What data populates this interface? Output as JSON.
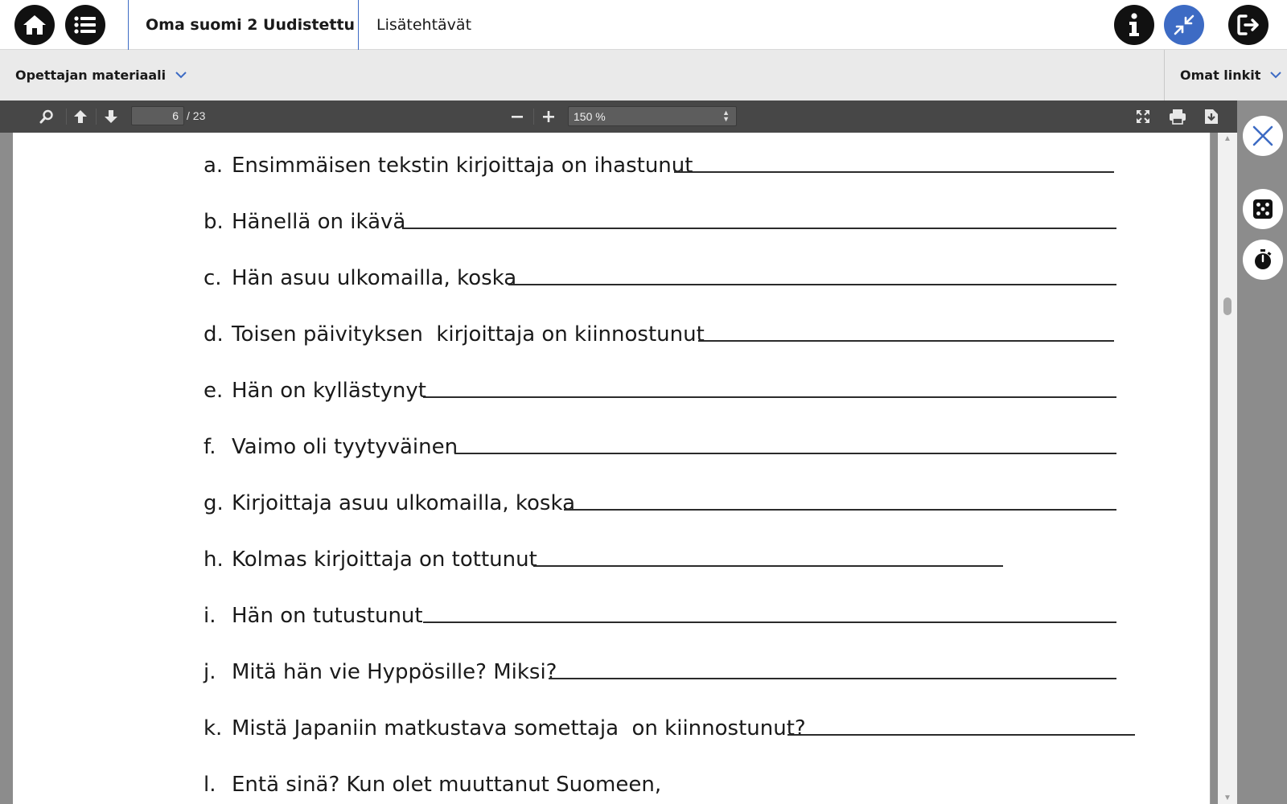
{
  "topbar": {
    "home_icon": "home-icon",
    "menu_icon": "list-icon",
    "book_title": "Oma suomi 2 Uudistettu",
    "extra_tab": "Lisätehtävät",
    "info_icon": "info-icon",
    "collapse_icon": "collapse-icon",
    "logout_icon": "logout-icon",
    "accent_color": "#3d6bc4"
  },
  "subbar": {
    "teacher_menu": "Opettajan materiaali",
    "links_menu": "Omat linkit"
  },
  "pdf_toolbar": {
    "current_page": "6",
    "page_count": "/ 23",
    "zoom": "150 %"
  },
  "worksheet": {
    "questions": [
      {
        "letter": "a.",
        "text": "Ensimmäisen tekstin kirjoittaja on ihastunut"
      },
      {
        "letter": "b.",
        "text": "Hänellä on ikävä"
      },
      {
        "letter": "c.",
        "text": "Hän asuu ulkomailla, koska"
      },
      {
        "letter": "d.",
        "text": "Toisen päivityksen  kirjoittaja on kiinnostunut"
      },
      {
        "letter": "e.",
        "text": "Hän on kyllästynyt"
      },
      {
        "letter": "f.",
        "text": "Vaimo oli tyytyväinen"
      },
      {
        "letter": "g.",
        "text": "Kirjoittaja asuu ulkomailla, koska"
      },
      {
        "letter": "h.",
        "text": "Kolmas kirjoittaja on tottunut"
      },
      {
        "letter": "i.",
        "text": "Hän on tutustunut"
      },
      {
        "letter": "j.",
        "text": "Mitä hän vie Hyppösille? Miksi?"
      },
      {
        "letter": "k.",
        "text": "Mistä Japaniin matkustava somettaja  on kiinnostunut?"
      },
      {
        "letter": "l.",
        "text": "Entä sinä? Kun olet muuttanut Suomeen,"
      }
    ]
  },
  "side_tools": {
    "close_icon": "close-icon",
    "dice_icon": "dice-icon",
    "timer_icon": "stopwatch-icon"
  }
}
